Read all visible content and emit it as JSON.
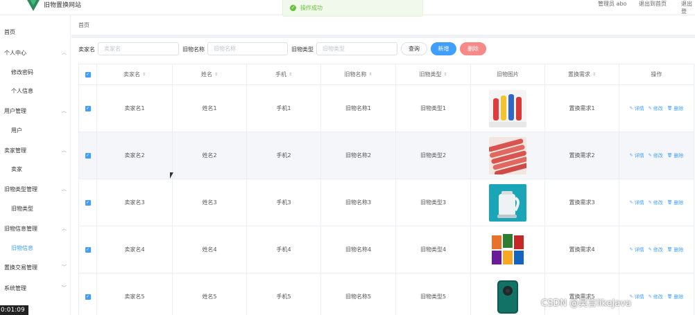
{
  "header": {
    "site_title": "旧物置换网站",
    "admin_label": "管理员 abo",
    "exit_home": "退出到首页",
    "logout": "退出登"
  },
  "toast": {
    "text": "操作成功"
  },
  "sidebar": {
    "home": "首页",
    "groups": [
      {
        "label": "个人中心",
        "items": [
          "修改密码",
          "个人信息"
        ]
      },
      {
        "label": "用户管理",
        "items": [
          "用户"
        ]
      },
      {
        "label": "卖家管理",
        "items": [
          "卖家"
        ]
      },
      {
        "label": "旧物类型管理",
        "items": [
          "旧物类型"
        ]
      },
      {
        "label": "旧物信息管理",
        "items": [
          "旧物信息"
        ]
      },
      {
        "label": "置换交易管理",
        "items": []
      },
      {
        "label": "系统管理",
        "items": []
      }
    ],
    "active_item": "旧物信息"
  },
  "timer": "0:01:09",
  "breadcrumb": "首页",
  "search": {
    "seller_label": "卖家名",
    "seller_placeholder": "卖家名",
    "item_name_label": "旧物名称",
    "item_name_placeholder": "旧物名称",
    "item_type_label": "旧物类型",
    "item_type_placeholder": "旧物类型",
    "query_button": "查询",
    "add_button": "新增",
    "delete_button": "删除"
  },
  "table": {
    "columns": [
      "卖家名",
      "姓名",
      "手机",
      "旧物名称",
      "旧物类型",
      "旧物图片",
      "置换需求",
      "操作"
    ],
    "rows": [
      {
        "seller": "卖家名1",
        "name": "姓名1",
        "phone": "手机1",
        "item_name": "旧物名称1",
        "item_type": "旧物类型1",
        "image": "bottles",
        "need": "置换需求1"
      },
      {
        "seller": "卖家名2",
        "name": "姓名2",
        "phone": "手机2",
        "item_name": "旧物名称2",
        "item_type": "旧物类型2",
        "image": "sausages",
        "need": "置换需求2"
      },
      {
        "seller": "卖家名3",
        "name": "姓名3",
        "phone": "手机3",
        "item_name": "旧物名称3",
        "item_type": "旧物类型3",
        "image": "kettle",
        "need": "置换需求3"
      },
      {
        "seller": "卖家名4",
        "name": "姓名4",
        "phone": "手机4",
        "item_name": "旧物名称4",
        "item_type": "旧物类型4",
        "image": "snacks",
        "need": "置换需求4"
      },
      {
        "seller": "卖家名5",
        "name": "姓名5",
        "phone": "手机5",
        "item_name": "旧物名称5",
        "item_type": "旧物类型5",
        "image": "phone",
        "need": "置换需求5"
      }
    ],
    "ops": {
      "detail": "详情",
      "edit": "修改",
      "delete": "删除"
    }
  },
  "watermark": "CSDN @昊言likeJava"
}
